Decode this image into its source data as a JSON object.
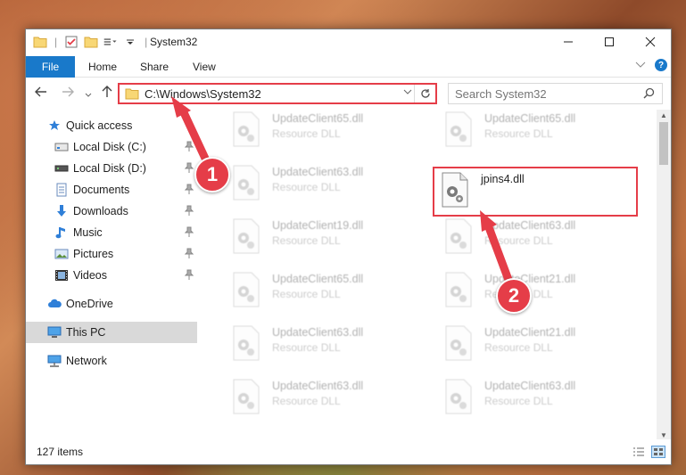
{
  "window": {
    "title": "System32"
  },
  "ribbon": {
    "tabs": [
      "File",
      "Home",
      "Share",
      "View"
    ]
  },
  "address": {
    "path": "C:\\Windows\\System32"
  },
  "search": {
    "placeholder": "Search System32"
  },
  "sidebar": {
    "items": [
      {
        "label": "Quick access",
        "icon": "star-icon",
        "pinned": false
      },
      {
        "label": "Local Disk (C:)",
        "icon": "drive-icon",
        "pinned": true
      },
      {
        "label": "Local Disk (D:)",
        "icon": "drive-icon",
        "pinned": true
      },
      {
        "label": "Documents",
        "icon": "documents-icon",
        "pinned": true
      },
      {
        "label": "Downloads",
        "icon": "download-icon",
        "pinned": true
      },
      {
        "label": "Music",
        "icon": "music-icon",
        "pinned": true
      },
      {
        "label": "Pictures",
        "icon": "pictures-icon",
        "pinned": true
      },
      {
        "label": "Videos",
        "icon": "videos-icon",
        "pinned": true
      },
      {
        "label": "OneDrive",
        "icon": "cloud-icon",
        "pinned": false
      },
      {
        "label": "This PC",
        "icon": "computer-icon",
        "pinned": false
      },
      {
        "label": "Network",
        "icon": "network-icon",
        "pinned": false
      }
    ]
  },
  "files": [
    {
      "name": "UpdateClient65.dll",
      "type": "Resource DLL"
    },
    {
      "name": "UpdateClient65.dll",
      "type": "Resource DLL"
    },
    {
      "name": "UpdateClient63.dll",
      "type": "Resource DLL"
    },
    {
      "name": "jpins4.dll",
      "type": ""
    },
    {
      "name": "UpdateClient19.dll",
      "type": "Resource DLL"
    },
    {
      "name": "UpdateClient63.dll",
      "type": "Resource DLL"
    },
    {
      "name": "UpdateClient65.dll",
      "type": "Resource DLL"
    },
    {
      "name": "UpdateClient21.dll",
      "type": "Resource DLL"
    },
    {
      "name": "UpdateClient63.dll",
      "type": "Resource DLL"
    },
    {
      "name": "UpdateClient21.dll",
      "type": "Resource DLL"
    },
    {
      "name": "UpdateClient63.dll",
      "type": "Resource DLL"
    },
    {
      "name": "UpdateClient63.dll",
      "type": "Resource DLL"
    }
  ],
  "status": {
    "item_count": "127 items"
  },
  "callouts": [
    "1",
    "2"
  ],
  "colors": {
    "accent": "#1979ca",
    "highlight": "#e53d48",
    "selected": "#d9d9d9"
  }
}
